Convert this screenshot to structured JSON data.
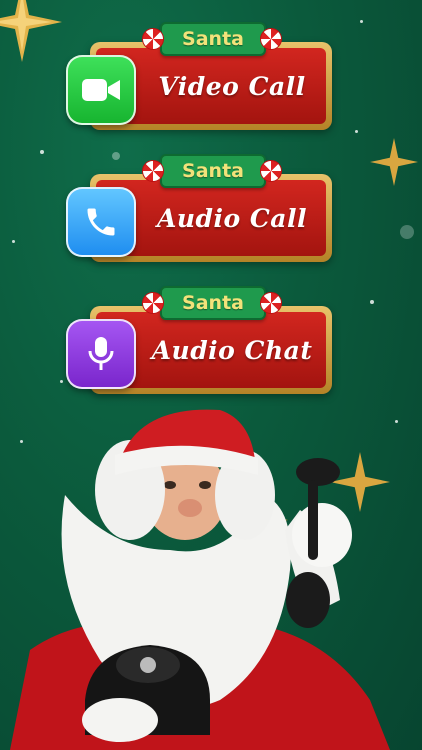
{
  "buttons": [
    {
      "badge": "Santa",
      "label": "Video Call",
      "icon": "video-camera-icon",
      "icon_color": "#1fc93a"
    },
    {
      "badge": "Santa",
      "label": "Audio Call",
      "icon": "phone-icon",
      "icon_color": "#2aa4f4"
    },
    {
      "badge": "Santa",
      "label": "Audio Chat",
      "icon": "microphone-icon",
      "icon_color": "#8a3ad8"
    }
  ],
  "colors": {
    "background": "#0b5a3c",
    "tile_red": "#c41d17",
    "tile_gold": "#d4a64a",
    "badge_green": "#1f9a4d"
  },
  "illustration": "santa-with-telephone"
}
